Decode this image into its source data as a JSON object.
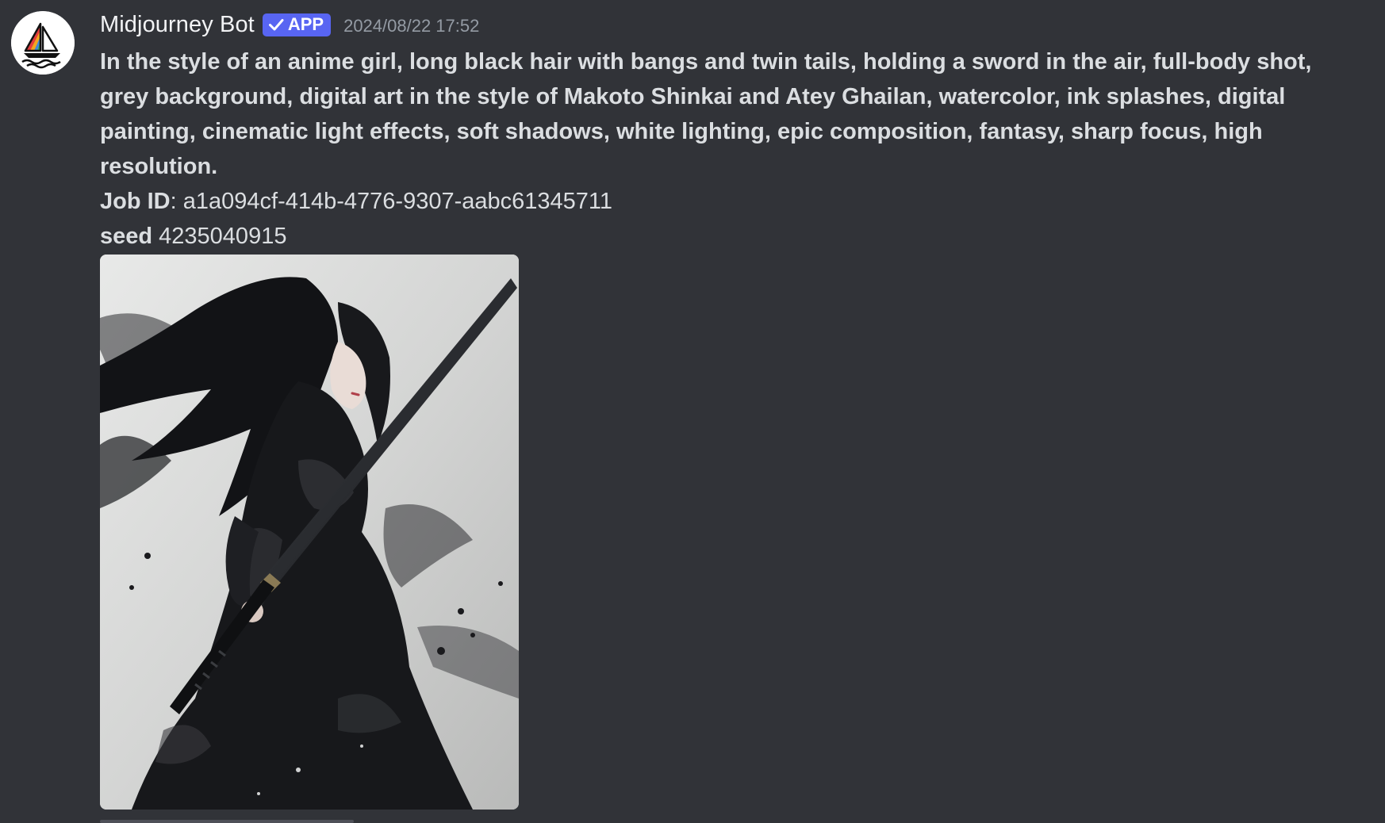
{
  "message": {
    "author": "Midjourney Bot",
    "badge": "APP",
    "timestamp": "2024/08/22 17:52",
    "prompt": "In the style of an anime girl, long black hair with bangs and twin tails, holding a sword in the air, full-body shot, grey background, digital art in the style of Makoto Shinkai and Atey Ghailan, watercolor, ink splashes, digital painting, cinematic light effects, soft shadows, white lighting, epic composition, fantasy, sharp focus, high resolution.",
    "job_label": "Job ID",
    "job_id": ": a1a094cf-414b-4776-9307-aabc61345711",
    "seed_label": "seed",
    "seed": " 4235040915"
  },
  "icons": {
    "avatar": "midjourney-sailboat-icon",
    "badge": "checkmark-icon"
  },
  "colors": {
    "background": "#313338",
    "badge": "#5865f2",
    "text": "#dbdee1",
    "timestamp": "#949ba4"
  }
}
